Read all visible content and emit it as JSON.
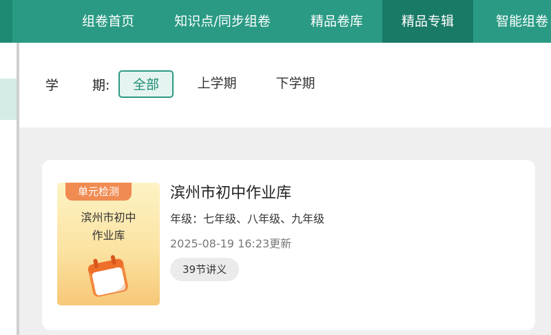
{
  "nav": {
    "items": [
      {
        "label": "组卷首页"
      },
      {
        "label": "知识点/同步组卷"
      },
      {
        "label": "精品卷库"
      },
      {
        "label": "精品专辑"
      },
      {
        "label": "智能组卷"
      }
    ],
    "active_index": 3,
    "color": "#2a9a84",
    "active_color": "#197a66"
  },
  "filter": {
    "label_first": "学",
    "label_second": "期:",
    "options": [
      {
        "label": "全部",
        "selected": true
      },
      {
        "label": "上学期",
        "selected": false
      },
      {
        "label": "下学期",
        "selected": false
      }
    ]
  },
  "card": {
    "cover": {
      "tag": "单元检测",
      "title_line1": "滨州市初中",
      "title_line2": "作业库",
      "icon": "calendar-icon"
    },
    "title": "滨州市初中作业库",
    "grade": "年级：七年级、八年级、九年级",
    "updated": "2025-08-19 16:23更新",
    "badge": "39节讲义"
  }
}
